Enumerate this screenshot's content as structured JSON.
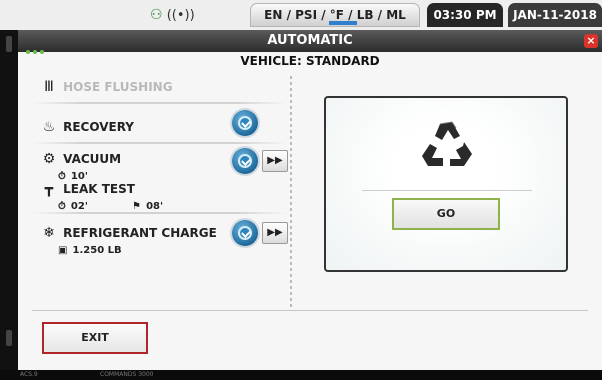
{
  "statusbar": {
    "units": "EN / PSI / °F / LB / ML",
    "time": "03:30 PM",
    "date": "JAN-11-2018",
    "icons": {
      "network": "people-icon",
      "wireless": "wireless-icon"
    }
  },
  "window": {
    "title": "AUTOMATIC",
    "close_glyph": "×",
    "vehicle": "VEHICLE: STANDARD"
  },
  "steps": {
    "hose_flushing": {
      "label": "HOSE FLUSHING"
    },
    "recovery": {
      "label": "RECOVERY"
    },
    "vacuum": {
      "label": "VACUUM",
      "time": "10'"
    },
    "leak_test": {
      "label": "LEAK TEST",
      "time": "02'",
      "flag_time": "08'"
    },
    "refrigerant_charge": {
      "label": "REFRIGERANT CHARGE",
      "amount": "1.250 LB"
    }
  },
  "buttons": {
    "go": "GO",
    "exit": "EXIT",
    "skip": "▶▶"
  },
  "bottombar": {
    "left": "ACS.9",
    "center": "COMMANDS 3000"
  },
  "colors": {
    "accent_blue": "#1e6a9c",
    "go_border": "#8fb34b",
    "exit_border": "#b0252a",
    "close_red": "#d9342b"
  }
}
